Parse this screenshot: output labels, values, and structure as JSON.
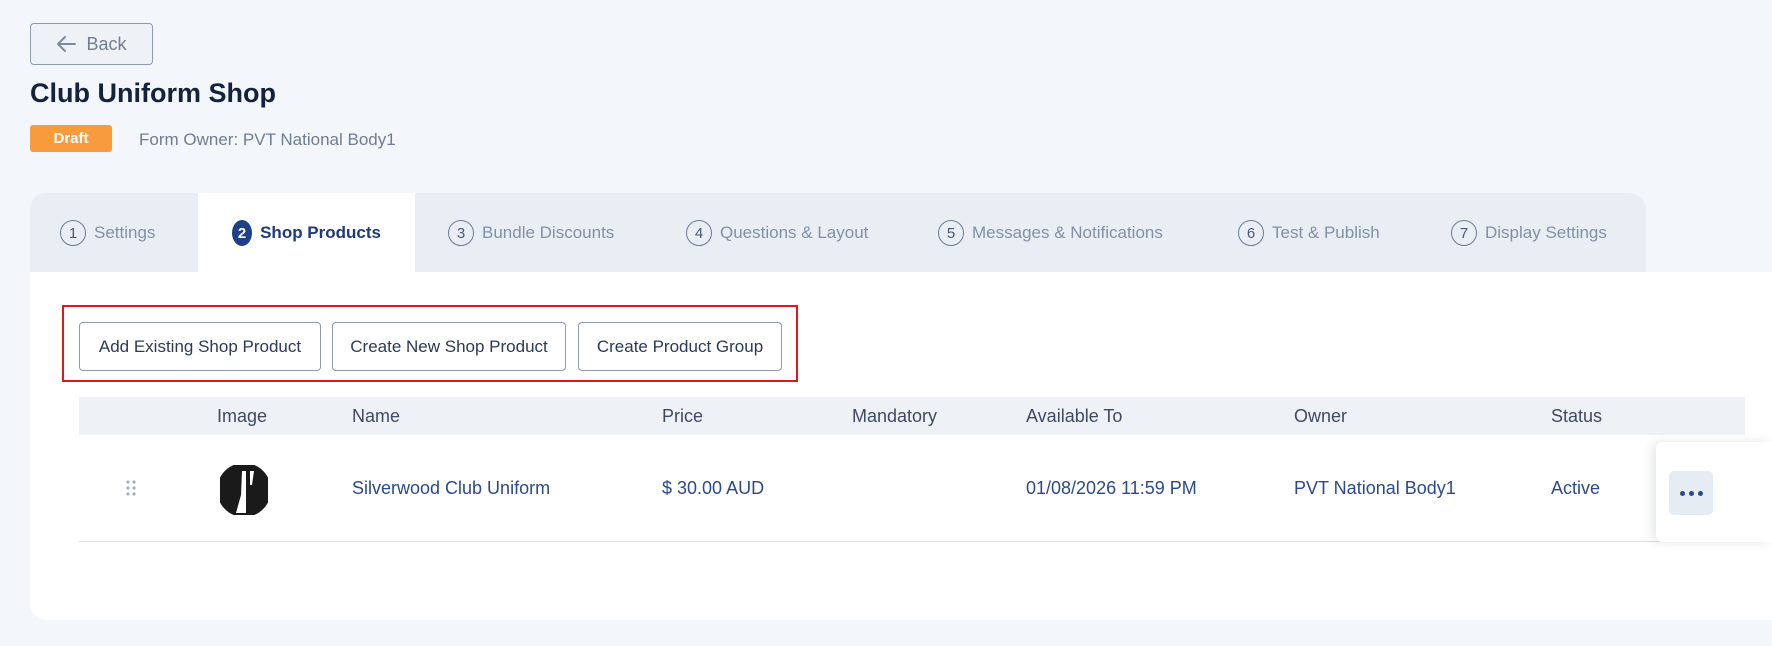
{
  "header": {
    "back_label": "Back",
    "title": "Club Uniform Shop",
    "status_badge": "Draft",
    "form_owner": "Form Owner: PVT National Body1"
  },
  "tabs": [
    {
      "num": "1",
      "label": "Settings",
      "active": false
    },
    {
      "num": "2",
      "label": "Shop Products",
      "active": true
    },
    {
      "num": "3",
      "label": "Bundle Discounts",
      "active": false
    },
    {
      "num": "4",
      "label": "Questions & Layout",
      "active": false
    },
    {
      "num": "5",
      "label": "Messages & Notifications",
      "active": false
    },
    {
      "num": "6",
      "label": "Test & Publish",
      "active": false
    },
    {
      "num": "7",
      "label": "Display Settings",
      "active": false
    }
  ],
  "actions": {
    "add_existing": "Add Existing Shop Product",
    "create_new": "Create New Shop Product",
    "create_group": "Create Product Group"
  },
  "table": {
    "columns": [
      "Image",
      "Name",
      "Price",
      "Mandatory",
      "Available To",
      "Owner",
      "Status"
    ],
    "rows": [
      {
        "name": "Silverwood Club Uniform",
        "price": "$ 30.00 AUD",
        "mandatory": "",
        "available_to": "01/08/2026 11:59 PM",
        "owner": "PVT National Body1",
        "status": "Active"
      }
    ]
  },
  "icons": {
    "back": "arrow-left-icon",
    "drag": "drag-handle-icon",
    "more": "more-horizontal-icon"
  },
  "colors": {
    "draft_badge": "#f89b3c",
    "active_tab_accent": "#1f3f86",
    "highlight_outline": "#e01818"
  }
}
